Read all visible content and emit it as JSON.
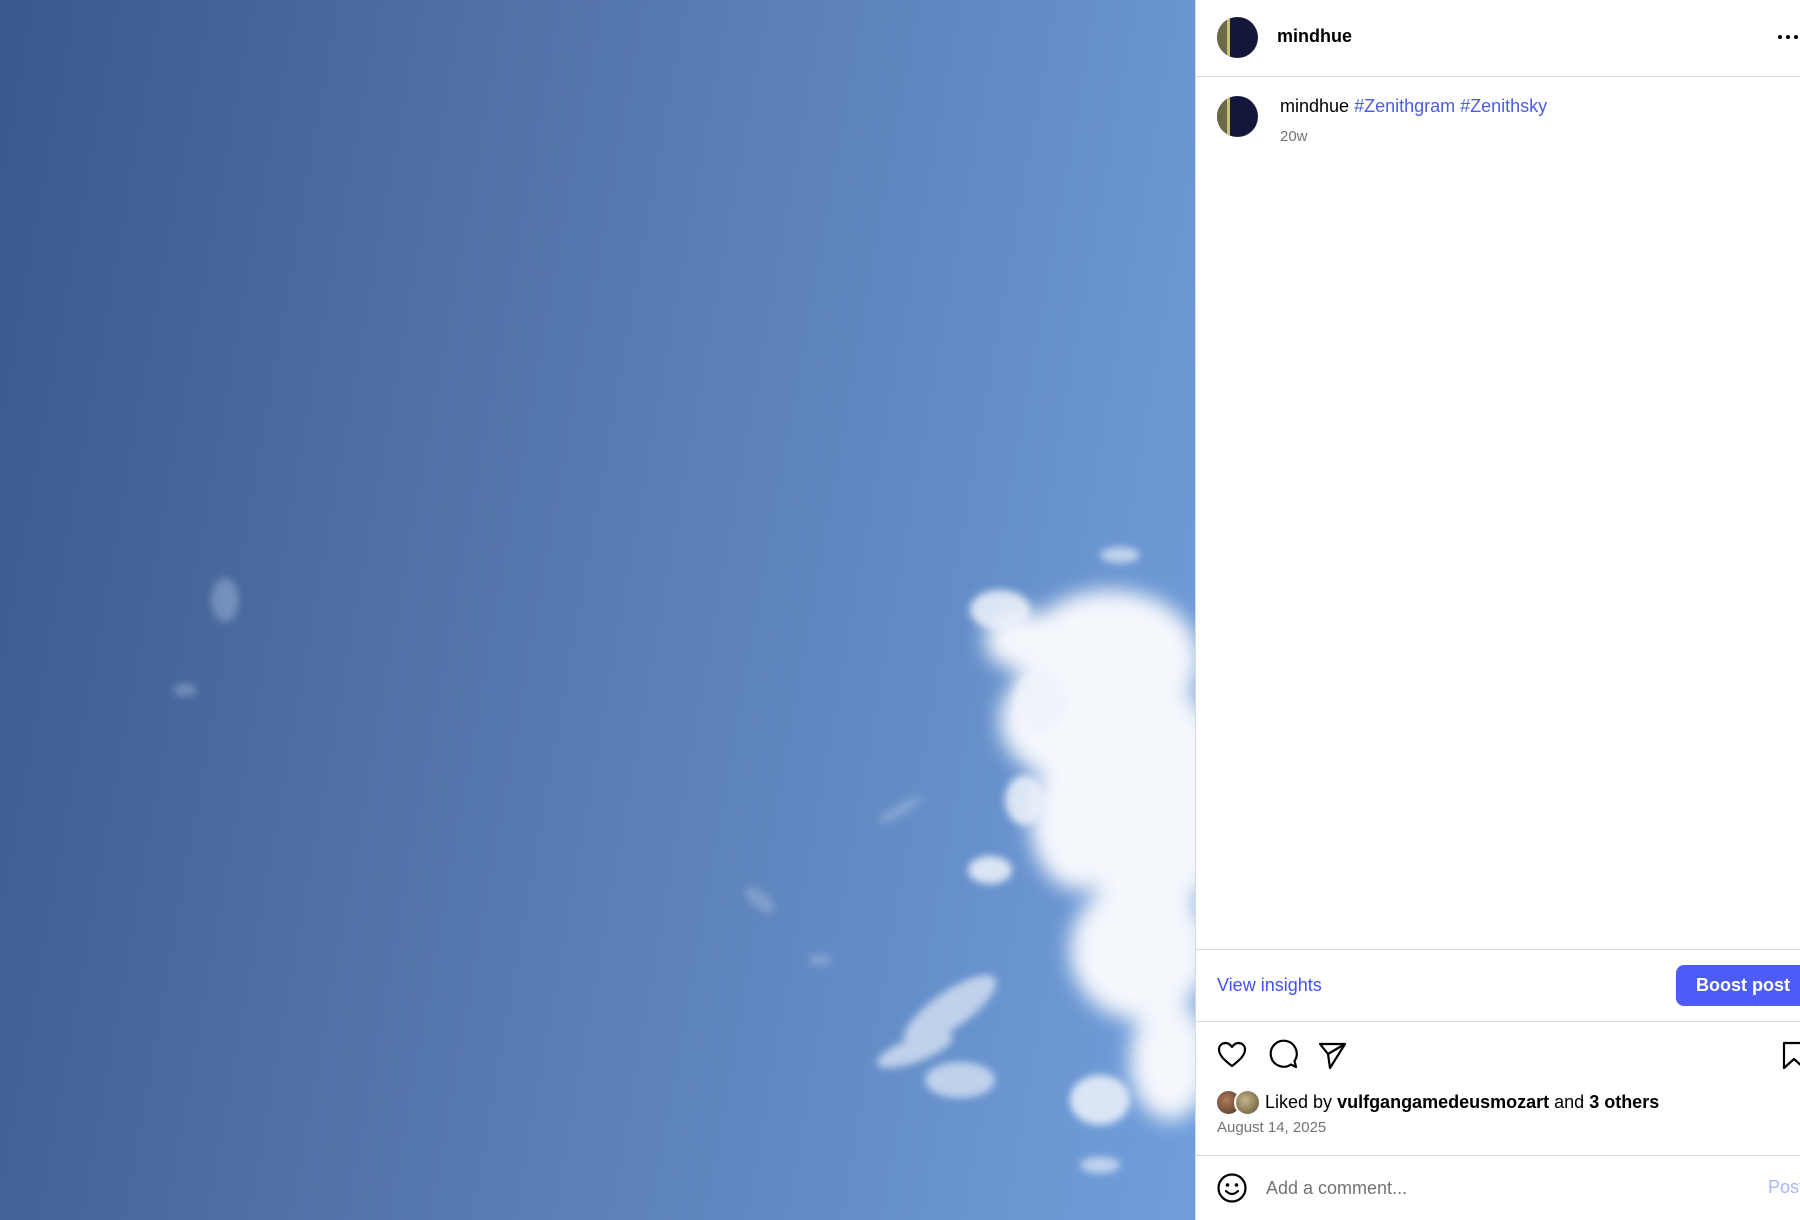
{
  "post": {
    "username": "mindhue",
    "caption_user": "mindhue",
    "hashtags": [
      "#Zenithgram",
      "#Zenithsky"
    ],
    "time_ago": "20w"
  },
  "actions": {
    "view_insights": "View insights",
    "boost_post": "Boost post"
  },
  "likes": {
    "prefix": "Liked by",
    "user": "vulfgangamedeusmozart",
    "joiner": "and",
    "others": "3 others"
  },
  "date": "August 14, 2025",
  "comment": {
    "placeholder": "Add a comment...",
    "value": "",
    "post_label": "Post"
  },
  "icons": {
    "more": "more-options-icon",
    "like": "heart-icon",
    "comment": "comment-icon",
    "share": "send-icon",
    "save": "bookmark-icon",
    "emoji": "emoji-icon"
  },
  "colors": {
    "link": "#4150f7",
    "hashtag": "#4a5ce6",
    "boost_bg": "#4d5cf6",
    "sky_dark": "#39598c",
    "sky_light": "#719fdc"
  }
}
